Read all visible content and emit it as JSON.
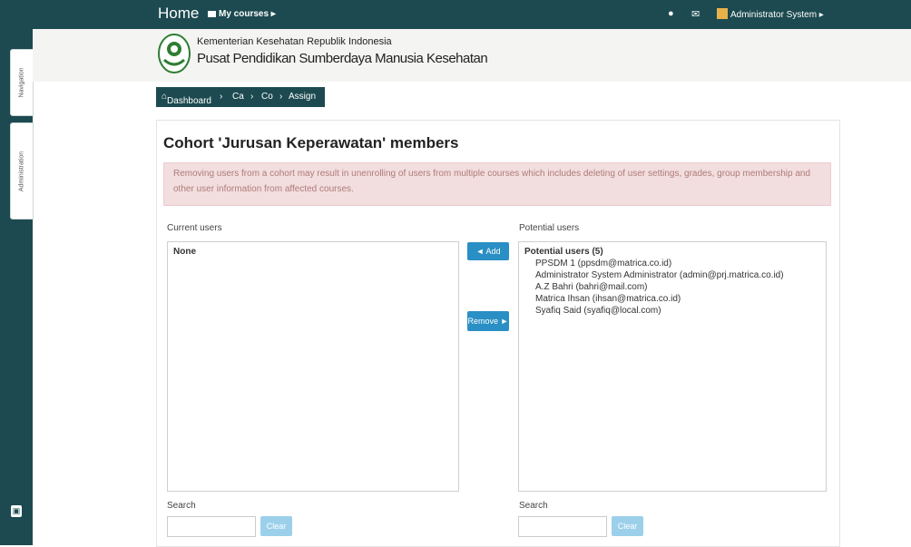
{
  "nav": {
    "home": "Home",
    "my_courses": "My courses ▸",
    "user": "Administrator System ▸"
  },
  "drawer": {
    "tab1": "Navigation",
    "tab2": "Administration"
  },
  "header": {
    "org_line1": "Kementerian Kesehatan Republik Indonesia",
    "org_line2": "Pusat Pendidikan Sumberdaya Manusia Kesehatan"
  },
  "breadcrumb": {
    "dashboard": "Dashboard",
    "c1": "Ca",
    "c2": "Co",
    "c3": "Assign"
  },
  "page": {
    "title": "Cohort 'Jurusan Keperawatan' members",
    "alert": "Removing users from a cohort may result in unenrolling of users from multiple courses which includes deleting of user settings, grades, group membership and other user information from affected courses."
  },
  "current": {
    "label": "Current users",
    "none": "None",
    "search_label": "Search",
    "clear": "Clear"
  },
  "buttons": {
    "add": "◄ Add",
    "remove": "Remove ►"
  },
  "potential": {
    "label": "Potential users",
    "group": "Potential users (5)",
    "items": [
      "PPSDM 1 (ppsdm@matrica.co.id)",
      "Administrator System Administrator (admin@prj.matrica.co.id)",
      "A.Z Bahri (bahri@mail.com)",
      "Matrica Ihsan (ihsan@matrica.co.id)",
      "Syafiq Said (syafiq@local.com)"
    ],
    "search_label": "Search",
    "clear": "Clear"
  }
}
